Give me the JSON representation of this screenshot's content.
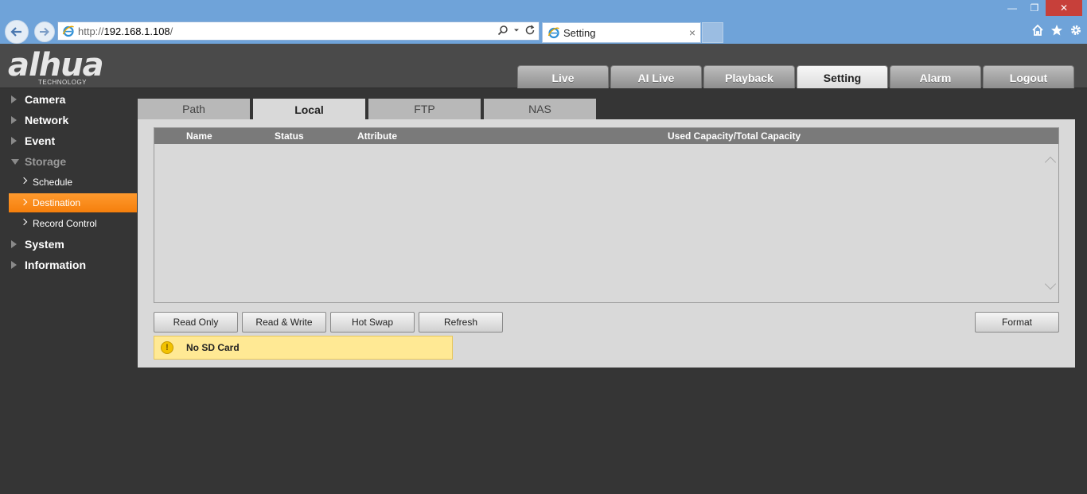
{
  "browser": {
    "url_proto": "http://",
    "url_host": "192.168.1.108",
    "url_rest": "/",
    "tab_title": "Setting",
    "tab_close": "×"
  },
  "header": {
    "logo_text": "alhua",
    "logo_sub": "TECHNOLOGY",
    "tabs": [
      "Live",
      "AI Live",
      "Playback",
      "Setting",
      "Alarm",
      "Logout"
    ],
    "active_tab": "Setting"
  },
  "sidebar": {
    "camera": "Camera",
    "network": "Network",
    "event": "Event",
    "storage": "Storage",
    "schedule": "Schedule",
    "destination": "Destination",
    "record_control": "Record Control",
    "system": "System",
    "information": "Information"
  },
  "content": {
    "tabs": [
      "Path",
      "Local",
      "FTP",
      "NAS"
    ],
    "active_tab": "Local",
    "columns": {
      "name": "Name",
      "status": "Status",
      "attribute": "Attribute",
      "capacity": "Used Capacity/Total Capacity"
    },
    "buttons": {
      "read_only": "Read Only",
      "read_write": "Read & Write",
      "hot_swap": "Hot Swap",
      "refresh": "Refresh",
      "format": "Format"
    },
    "notice": "No SD Card"
  },
  "colors": {
    "accent": "#f58a1f",
    "chrome": "#6fa3d9",
    "background": "#353535"
  }
}
